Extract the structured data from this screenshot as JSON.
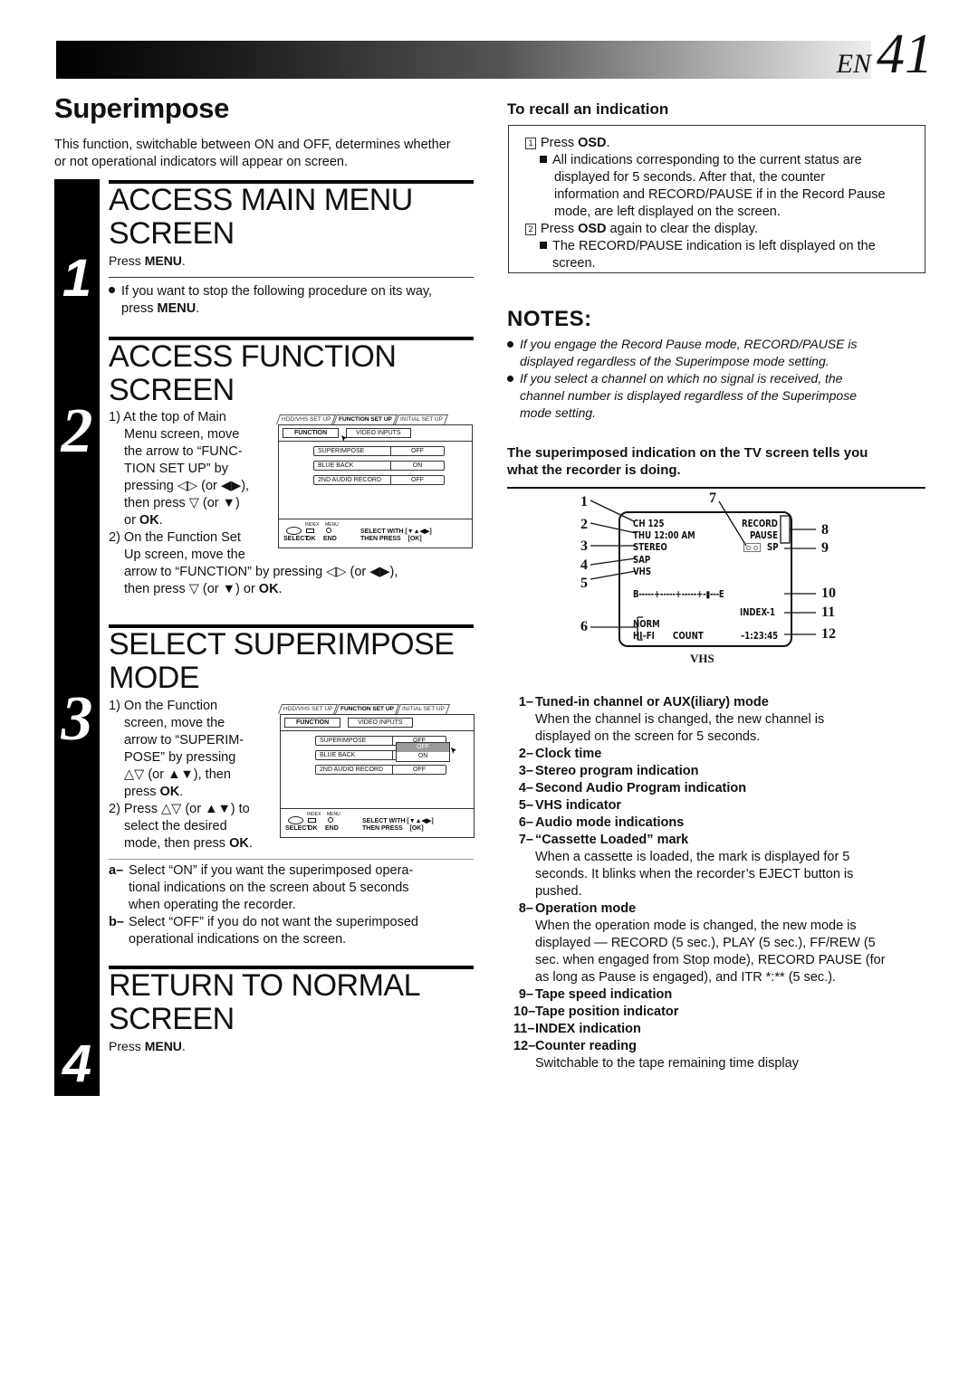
{
  "header": {
    "lang": "EN",
    "page_number": "41"
  },
  "title": "Superimpose",
  "intro": "This function, switchable between ON and OFF, determines whether or not operational indicators will appear on screen.",
  "steps": [
    {
      "number": "1",
      "title_line1": "ACCESS MAIN MENU",
      "title_line2": "SCREEN",
      "press_prefix": "Press ",
      "press_key": "MENU",
      "press_suffix": ".",
      "note_prefix": "If you want to stop the following procedure on its way, press ",
      "note_key": "MENU",
      "note_suffix": "."
    },
    {
      "number": "2",
      "title_line1": "ACCESS FUNCTION",
      "title_line2": "SCREEN",
      "lines": [
        "1) At the top of Main",
        "Menu screen, move",
        "the arrow to “FUNC-",
        "TION SET UP” by",
        "pressing ◁▷ (or ◀▶),",
        "then press ▽  (or ▼)",
        "or ",
        "2) On the Function Set",
        "Up screen, move the",
        "arrow to “FUNCTION” by pressing ◁▷ (or ◀▶),",
        "then press ▽  (or ▼) or "
      ],
      "ok": "OK",
      "period": "."
    },
    {
      "number": "3",
      "title_line1": "SELECT SUPERIMPOSE",
      "title_line2": "MODE",
      "lines": [
        "1) On the Function",
        "screen, move the",
        "arrow to “SUPERIM-",
        "POSE” by pressing",
        "△▽ (or ▲▼), then",
        "press ",
        "2) Press △▽ (or ▲▼) to",
        "select the desired",
        "mode, then press "
      ],
      "ok": "OK",
      "period": ".",
      "options": [
        {
          "key": "a–",
          "text_l1": "Select “ON” if you want the superimposed opera-",
          "text_l2": "tional indications on the screen about 5 seconds",
          "text_l3": "when operating the recorder."
        },
        {
          "key": "b–",
          "text_l1": "Select “OFF” if you do not want the superimposed",
          "text_l2": "operational indications on the screen."
        }
      ]
    },
    {
      "number": "4",
      "title_line1": "RETURN TO NORMAL",
      "title_line2": "SCREEN",
      "press_prefix": "Press ",
      "press_key": "MENU",
      "press_suffix": "."
    }
  ],
  "menu_screen": {
    "tabs": [
      "HDD/VHS SET UP",
      "FUNCTION SET UP",
      "INITIAL SET UP"
    ],
    "active_tab": "FUNCTION SET UP",
    "subtabs": [
      "FUNCTION",
      "VIDEO INPUTS"
    ],
    "rows": [
      {
        "label": "SUPERIMPOSE",
        "value": "OFF"
      },
      {
        "label": "BLUE BACK",
        "value": "ON"
      },
      {
        "label": "2ND AUDIO RECORD",
        "value": "OFF"
      }
    ],
    "dropdown_options": [
      "OFF",
      "ON"
    ],
    "dropdown_selected": "OFF",
    "footer": {
      "index_label": "INDEX",
      "menu_label": "MENU",
      "select": "SELECT",
      "ok": "OK",
      "end": "END",
      "select_with": "SELECT WITH [▼▲◀▶]",
      "then_press": "THEN PRESS    [OK]"
    }
  },
  "recall": {
    "title": "To recall an indication",
    "step1_num": "1",
    "step1_prefix": "Press ",
    "step1_key": "OSD",
    "step1_suffix": ".",
    "step1_note": [
      "All indications corresponding to the current status are",
      "displayed for 5 seconds. After that, the counter",
      "information and RECORD/PAUSE if in the Record Pause",
      "mode, are left displayed on the screen."
    ],
    "step2_num": "2",
    "step2_prefix": "Press ",
    "step2_key": "OSD",
    "step2_suffix": " again to clear the display.",
    "step2_note": [
      "The RECORD/PAUSE indication is left displayed on the",
      "screen."
    ]
  },
  "notes": {
    "title": "NOTES:",
    "items": [
      [
        "If you engage the Record Pause mode, RECORD/PAUSE is",
        "displayed regardless of the Superimpose mode setting."
      ],
      [
        "If you select a channel on which no signal is received, the",
        "channel number is displayed regardless of the Superimpose",
        "mode setting."
      ]
    ]
  },
  "tv_intro": [
    "The superimposed indication on the TV screen tells you",
    "what the recorder is doing."
  ],
  "tv_display": {
    "channel": "CH    125",
    "clock": "THU  12:00 AM",
    "stereo": "STEREO",
    "sap": "SAP",
    "vhs": "VHS",
    "record": "RECORD",
    "pause": "PAUSE",
    "speed": "SP",
    "tape_bar": "B-----+-----+-----+-▮---E",
    "index": "INDEX-1",
    "norm": "NORM",
    "hifi": "HI–FI",
    "count": "COUNT",
    "counter": "–1:23:45",
    "caption": "VHS",
    "callouts": [
      "1",
      "2",
      "3",
      "4",
      "5",
      "6",
      "7",
      "8",
      "9",
      "10",
      "11",
      "12"
    ]
  },
  "legend": [
    {
      "n": "1–",
      "title": "Tuned-in channel or AUX(iliary) mode",
      "desc": [
        "When the channel is changed, the new channel is",
        "displayed on the screen for 5 seconds."
      ]
    },
    {
      "n": "2–",
      "title": "Clock time",
      "desc": []
    },
    {
      "n": "3–",
      "title": "Stereo program indication",
      "desc": []
    },
    {
      "n": "4–",
      "title": "Second Audio Program indication",
      "desc": []
    },
    {
      "n": "5–",
      "title": "VHS indicator",
      "desc": []
    },
    {
      "n": "6–",
      "title": "Audio mode indications",
      "desc": []
    },
    {
      "n": "7–",
      "title": "“Cassette Loaded” mark",
      "desc": [
        "When a cassette is loaded, the mark is displayed for 5",
        "seconds. It blinks when the recorder’s EJECT button is",
        "pushed."
      ]
    },
    {
      "n": "8–",
      "title": "Operation mode",
      "desc": [
        "When the operation mode is changed, the new mode is",
        "displayed — RECORD (5 sec.), PLAY (5 sec.), FF/REW (5",
        "sec. when engaged from Stop mode), RECORD PAUSE (for",
        "as long as Pause is engaged), and ITR *:** (5 sec.)."
      ]
    },
    {
      "n": "9–",
      "title": "Tape speed indication",
      "desc": []
    },
    {
      "n": "10–",
      "title": "Tape position indicator",
      "desc": []
    },
    {
      "n": "11–",
      "title": "INDEX indication",
      "desc": []
    },
    {
      "n": "12–",
      "title": "Counter reading",
      "desc": [
        "Switchable to the tape remaining time display"
      ]
    }
  ]
}
